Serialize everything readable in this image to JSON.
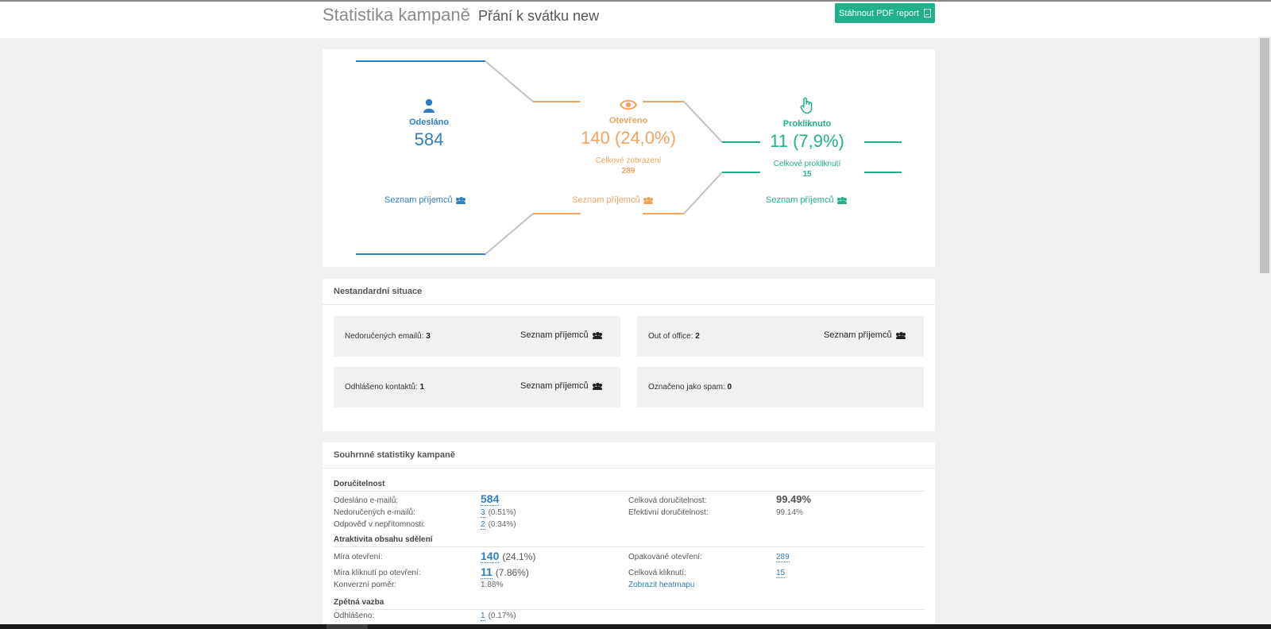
{
  "header": {
    "title": "Statistika kampaně",
    "campaign_name": "Přání k svátku new",
    "pdf_button": "Stáhnout PDF report"
  },
  "funnel": {
    "sent": {
      "label": "Odesláno",
      "value": "584",
      "link": "Seznam příjemců"
    },
    "opened": {
      "label": "Otevřeno",
      "value": "140 (24,0%)",
      "sub_label": "Celkové zobrazení",
      "sub_value": "289",
      "link": "Seznam příjemců"
    },
    "clicked": {
      "label": "Prokliknuto",
      "value": "11 (7,9%)",
      "sub_label": "Celkové prokliknutí",
      "sub_value": "15",
      "link": "Seznam příjemců"
    }
  },
  "nonstandard": {
    "title": "Nestandardní situace",
    "boxes": [
      {
        "label": "Nedoručených emailů:",
        "value": "3",
        "link": "Seznam příjemců"
      },
      {
        "label": "Out of office:",
        "value": "2",
        "link": "Seznam příjemců"
      },
      {
        "label": "Odhlášeno kontaktů:",
        "value": "1",
        "link": "Seznam příjemců"
      },
      {
        "label": "Označeno jako spam:",
        "value": "0"
      }
    ]
  },
  "summary": {
    "title": "Souhrnné statistiky kampaně",
    "deliverability": {
      "heading": "Doručitelnost",
      "sent_label": "Odesláno e-mailů:",
      "sent_value": "584",
      "undelivered_label": "Nedoručených e-mailů:",
      "undelivered_value": "3",
      "undelivered_pct": "(0.51%)",
      "absence_label": "Odpověď v nepřítomnosti:",
      "absence_value": "2",
      "absence_pct": "(0.34%)",
      "total_label": "Celková doručitelnost:",
      "total_value": "99.49%",
      "effective_label": "Efektivní doručitelnost:",
      "effective_value": "99.14%"
    },
    "attractiveness": {
      "heading": "Atraktivita obsahu sdělení",
      "open_rate_label": "Míra otevření:",
      "open_rate_value": "140",
      "open_rate_pct": "(24.1%)",
      "click_rate_label": "Míra kliknutí po otevření:",
      "click_rate_value": "11",
      "click_rate_pct": "(7.86%)",
      "conversion_label": "Konverzní poměr:",
      "conversion_value": "1.88%",
      "repeated_label": "Opakované otevření:",
      "repeated_value": "289",
      "total_clicks_label": "Celková kliknutí:",
      "total_clicks_value": "15",
      "heatmap_link": "Zobrazit heatmapu"
    },
    "feedback": {
      "heading": "Zpětná vazba",
      "unsub_label": "Odhlášeno:",
      "unsub_value": "1",
      "unsub_pct": "(0.17%)"
    }
  },
  "colors": {
    "sent": "#2f7ec1",
    "opened": "#f2a45e",
    "clicked": "#20b08c",
    "button": "#20b08c"
  }
}
